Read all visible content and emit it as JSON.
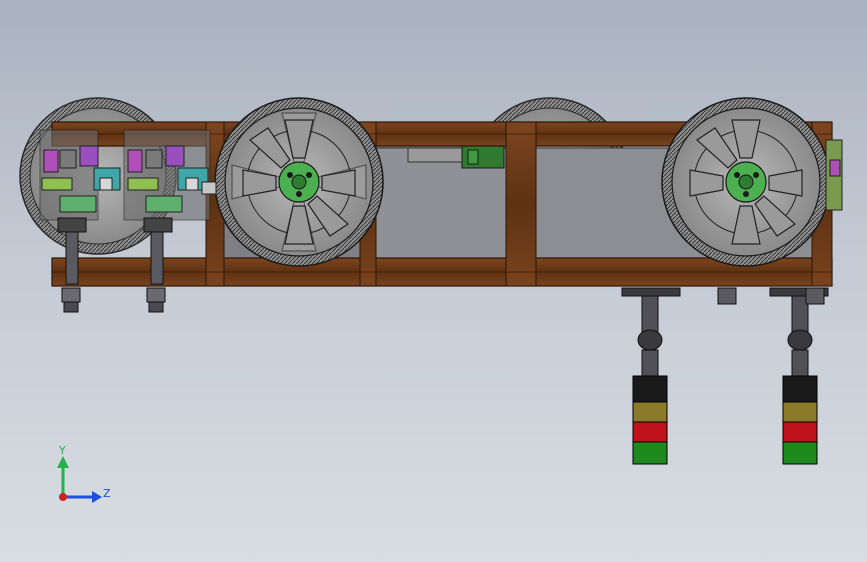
{
  "viewport": {
    "background_top": "#a9b2bf",
    "background_bottom": "#d9dde3"
  },
  "model": {
    "frame_color": "#6b3a16",
    "wheel_color": "#9c9c9c",
    "hub_color": "#4caf50",
    "panel_color": "#8f8f94",
    "indicator_colors": [
      "#1a1a1a",
      "#8a7a2a",
      "#c0121a",
      "#1e8a1e"
    ]
  },
  "triad": {
    "y_label": "Y",
    "z_label": "Z",
    "y_color": "#21b24b",
    "z_color": "#1d4fd8",
    "x_color": "#d02020"
  }
}
